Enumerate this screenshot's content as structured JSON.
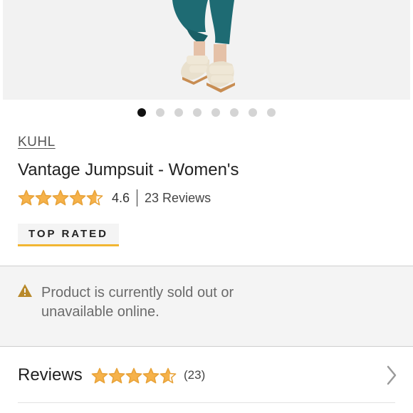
{
  "gallery": {
    "image_description_icon": "product-photo",
    "dot_count": 8,
    "active_index": 0
  },
  "product": {
    "brand": "KUHL",
    "title": "Vantage Jumpsuit - Women's",
    "rating": 4.6,
    "rating_text": "4.6",
    "reviews_text": "23 Reviews",
    "badge": "TOP RATED"
  },
  "notice": {
    "icon": "warning-icon",
    "text": "Product is currently sold out or unavailable online."
  },
  "reviews_section": {
    "label": "Reviews",
    "count_text": "(23)",
    "rating": 4.6,
    "chevron_icon": "chevron-right-icon"
  },
  "colors": {
    "star": "#e8a33a",
    "star_fill": "#f6b24a",
    "badge_underline": "#f2b632",
    "warning": "#b8892a",
    "active_dot": "#111111",
    "inactive_dot": "#d4d4d4"
  }
}
